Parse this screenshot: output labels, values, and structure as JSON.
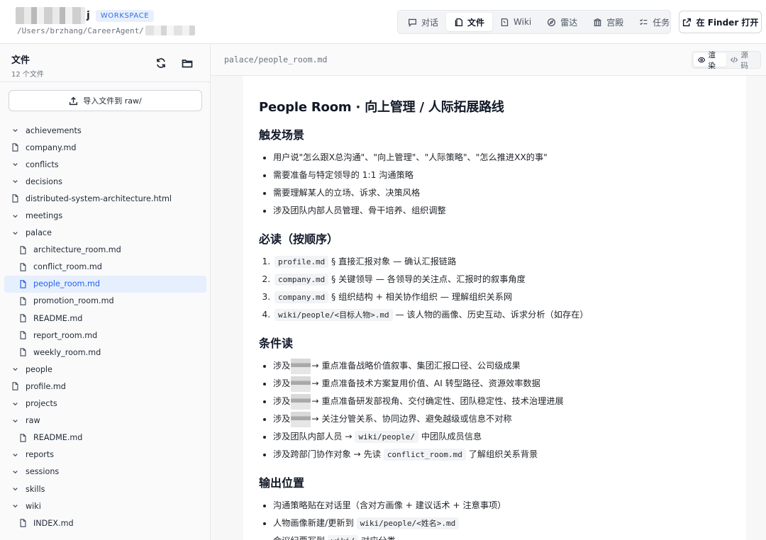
{
  "header": {
    "app_name_suffix": "j",
    "badge": "WORKSPACE",
    "path": "/Users/brzhang/CareerAgent/",
    "tabs": [
      {
        "label": "对话",
        "icon": "chat-icon",
        "active": false
      },
      {
        "label": "文件",
        "icon": "file-icon",
        "active": true
      },
      {
        "label": "Wiki",
        "icon": "book-icon",
        "active": false
      },
      {
        "label": "雷达",
        "icon": "compass-icon",
        "active": false
      },
      {
        "label": "宫殿",
        "icon": "palace-icon",
        "active": false
      },
      {
        "label": "任务",
        "icon": "checklist-icon",
        "active": false
      }
    ],
    "finder_button": "在 Finder 打开"
  },
  "sidebar": {
    "title": "文件",
    "count": "12 个文件",
    "import_button": "导入文件到 raw/",
    "tree": [
      {
        "label": "achievements",
        "type": "folder",
        "level": 0
      },
      {
        "label": "company.md",
        "type": "file",
        "level": 0
      },
      {
        "label": "conflicts",
        "type": "folder",
        "level": 0
      },
      {
        "label": "decisions",
        "type": "folder",
        "level": 0
      },
      {
        "label": "distributed-system-architecture.html",
        "type": "file",
        "level": 0
      },
      {
        "label": "meetings",
        "type": "folder",
        "level": 0
      },
      {
        "label": "palace",
        "type": "folder",
        "level": 0
      },
      {
        "label": "architecture_room.md",
        "type": "file",
        "level": 1
      },
      {
        "label": "conflict_room.md",
        "type": "file",
        "level": 1
      },
      {
        "label": "people_room.md",
        "type": "file",
        "level": 1,
        "active": true
      },
      {
        "label": "promotion_room.md",
        "type": "file",
        "level": 1
      },
      {
        "label": "README.md",
        "type": "file",
        "level": 1
      },
      {
        "label": "report_room.md",
        "type": "file",
        "level": 1
      },
      {
        "label": "weekly_room.md",
        "type": "file",
        "level": 1
      },
      {
        "label": "people",
        "type": "folder",
        "level": 0
      },
      {
        "label": "profile.md",
        "type": "file",
        "level": 0
      },
      {
        "label": "projects",
        "type": "folder",
        "level": 0
      },
      {
        "label": "raw",
        "type": "folder",
        "level": 0
      },
      {
        "label": "README.md",
        "type": "file",
        "level": 1
      },
      {
        "label": "reports",
        "type": "folder",
        "level": 0
      },
      {
        "label": "sessions",
        "type": "folder",
        "level": 0
      },
      {
        "label": "skills",
        "type": "folder",
        "level": 0
      },
      {
        "label": "wiki",
        "type": "folder",
        "level": 0
      },
      {
        "label": "INDEX.md",
        "type": "file",
        "level": 1
      }
    ]
  },
  "main": {
    "file_path": "palace/people_room.md",
    "view_toggle": {
      "render": "渲染",
      "source": "源码"
    },
    "doc": {
      "title": "People Room · 向上管理 / 人际拓展路线",
      "sections": [
        {
          "heading": "触发场景",
          "list": "ul",
          "items": [
            [
              {
                "t": "用户说\"怎么跟X总沟通\"、\"向上管理\"、\"人际策略\"、\"怎么推进XX的事\""
              }
            ],
            [
              {
                "t": "需要准备与特定领导的 1:1 沟通策略"
              }
            ],
            [
              {
                "t": "需要理解某人的立场、诉求、决策风格"
              }
            ],
            [
              {
                "t": "涉及团队内部人员管理、骨干培养、组织调整"
              }
            ]
          ]
        },
        {
          "heading": "必读（按顺序）",
          "list": "ol",
          "items": [
            [
              {
                "c": "profile.md"
              },
              {
                "t": " § 直接汇报对象 — 确认汇报链路"
              }
            ],
            [
              {
                "c": "company.md"
              },
              {
                "t": " § 关键领导 — 各领导的关注点、汇报时的叙事角度"
              }
            ],
            [
              {
                "c": "company.md"
              },
              {
                "t": " § 组织结构 + 相关协作组织 — 理解组织关系网"
              }
            ],
            [
              {
                "c": "wiki/people/<目标人物>.md"
              },
              {
                "t": " — 该人物的画像、历史互动、诉求分析（如存在）"
              }
            ]
          ]
        },
        {
          "heading": "条件读",
          "list": "ul",
          "items": [
            [
              {
                "t": "涉及"
              },
              {
                "r": true
              },
              {
                "t": "→ 重点准备战略价值叙事、集团汇报口径、公司级成果"
              }
            ],
            [
              {
                "t": "涉及"
              },
              {
                "r": true
              },
              {
                "t": "→ 重点准备技术方案复用价值、AI 转型路径、资源效率数据"
              }
            ],
            [
              {
                "t": "涉及"
              },
              {
                "r": true
              },
              {
                "t": "→ 重点准备研发部视角、交付确定性、团队稳定性、技术治理进展"
              }
            ],
            [
              {
                "t": "涉及"
              },
              {
                "r": true
              },
              {
                "t": "→ 关注分管关系、协同边界、避免越级或信息不对称"
              }
            ],
            [
              {
                "t": "涉及团队内部人员 → "
              },
              {
                "c": "wiki/people/"
              },
              {
                "t": " 中团队成员信息"
              }
            ],
            [
              {
                "t": "涉及跨部门协作对象 → 先读 "
              },
              {
                "c": "conflict_room.md"
              },
              {
                "t": " 了解组织关系背景"
              }
            ]
          ]
        },
        {
          "heading": "输出位置",
          "list": "ul",
          "items": [
            [
              {
                "t": "沟通策略贴在对话里（含对方画像 + 建议话术 + 注意事项）"
              }
            ],
            [
              {
                "t": "人物画像新建/更新到 "
              },
              {
                "c": "wiki/people/<姓名>.md"
              }
            ],
            [
              {
                "t": "会议纪要写到 "
              },
              {
                "c": "wiki/"
              },
              {
                "t": " 对应分类"
              }
            ]
          ]
        }
      ]
    }
  },
  "colors": {
    "accent": "#2563eb",
    "active_row_bg": "#e6effd",
    "badge_bg": "#e8f0fe"
  }
}
